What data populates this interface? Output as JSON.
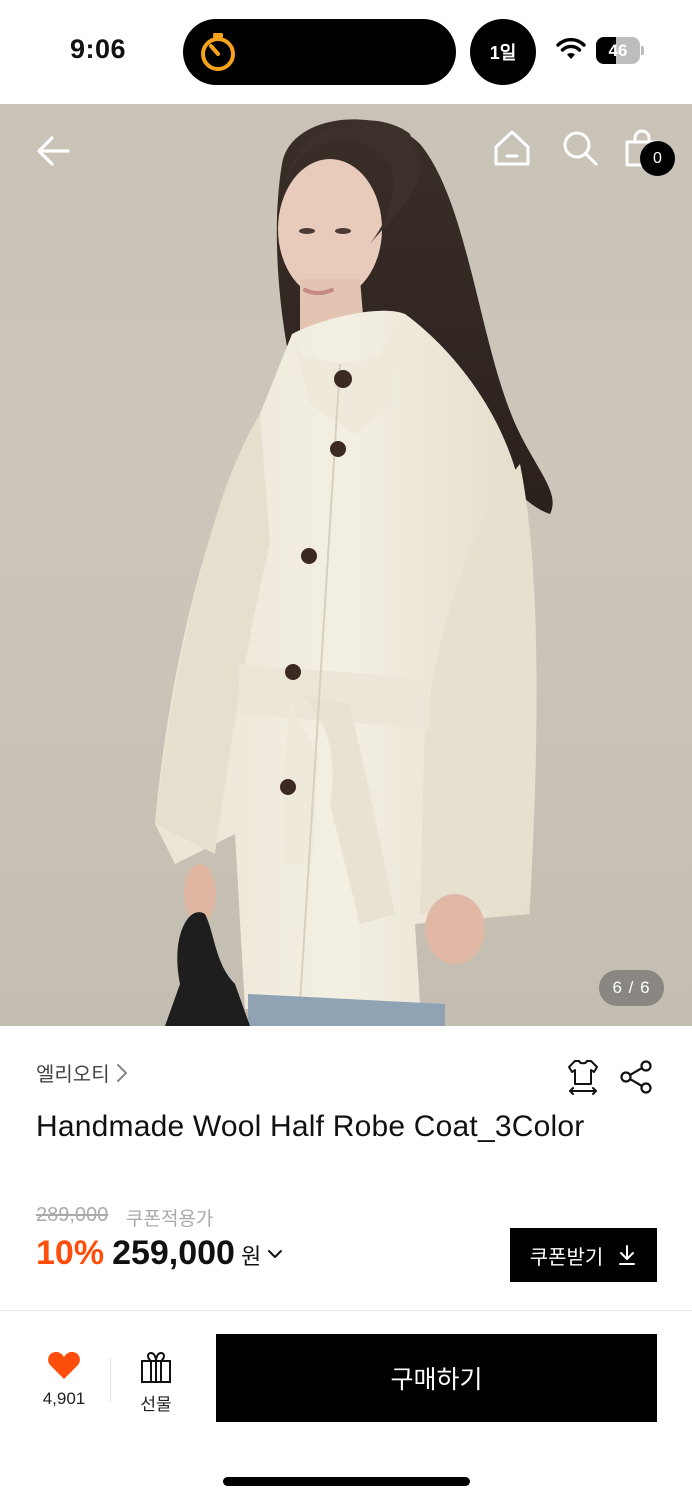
{
  "status_bar": {
    "time": "9:06",
    "pill_label": "1일",
    "battery_level": 46,
    "battery_text": "46",
    "timer_color": "#f7a21b"
  },
  "nav": {
    "icons": [
      "back-arrow-icon",
      "home-icon",
      "search-icon",
      "shopping-bag-icon"
    ],
    "cart_count": "0"
  },
  "gallery": {
    "page_indicator": "6 / 6",
    "current": 6,
    "total": 6
  },
  "product": {
    "brand": "엘리오티",
    "title": "Handmade Wool Half Robe Coat_3Color",
    "original_price": "289,000",
    "price_note": "쿠폰적용가",
    "discount": "10%",
    "price": "259,000",
    "currency": "원",
    "coupon_label": "쿠폰받기"
  },
  "bottom_bar": {
    "like_count": "4,901",
    "gift_label": "선물",
    "buy_label": "구매하기"
  },
  "colors": {
    "discount": "#ff4e0b",
    "heart": "#ff4e0b",
    "primary": "#000000"
  }
}
